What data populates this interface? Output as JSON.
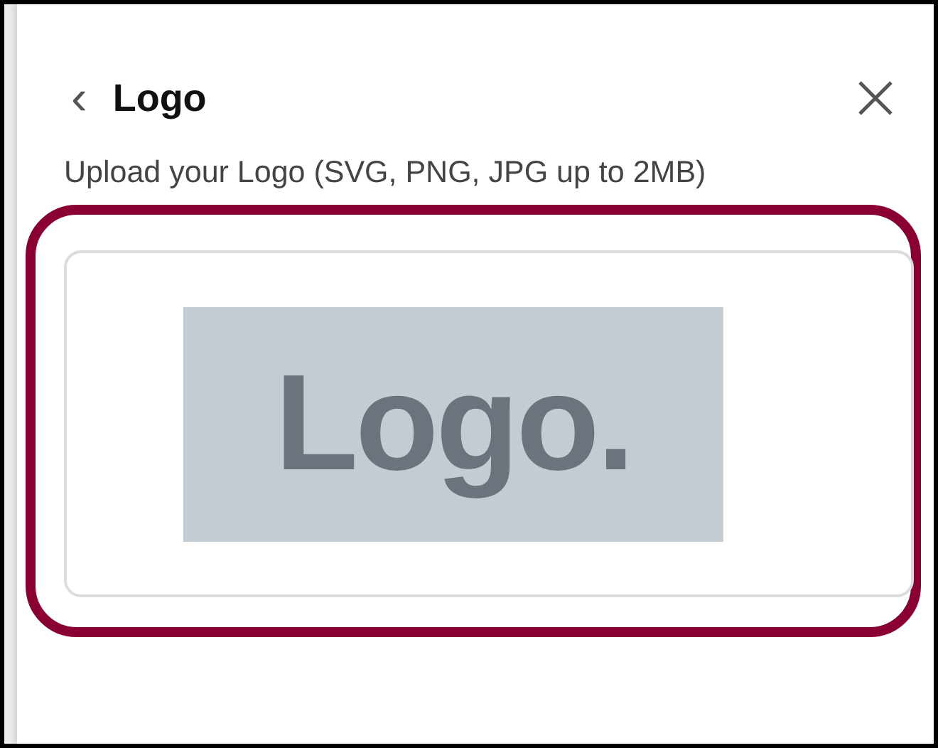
{
  "header": {
    "back": "‹",
    "title": "Logo"
  },
  "upload": {
    "label": "Upload your Logo (SVG, PNG, JPG up to 2MB)",
    "logo_text": "Logo."
  }
}
